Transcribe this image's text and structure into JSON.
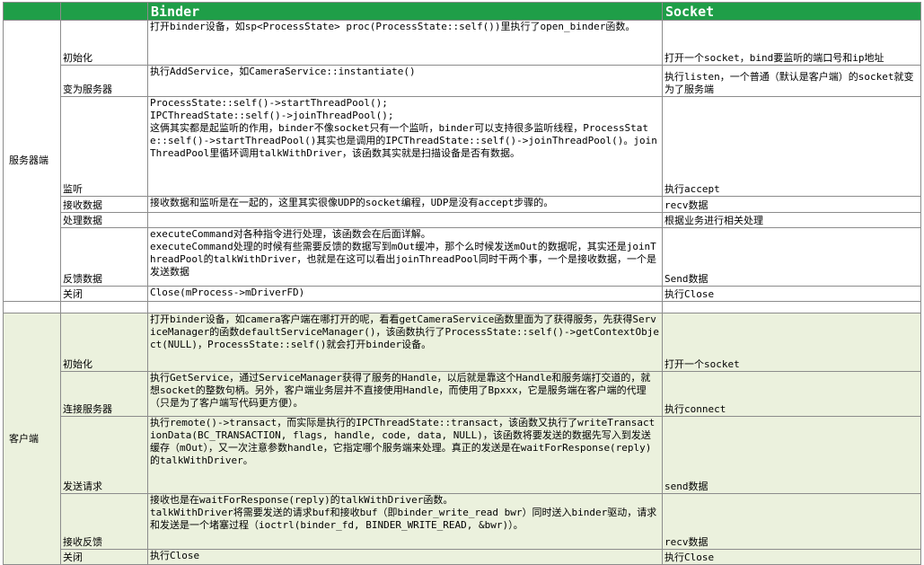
{
  "header": {
    "c0": "",
    "c1": "",
    "binder": "Binder",
    "socket": "Socket"
  },
  "server": {
    "section": "服务器端",
    "rows": [
      {
        "label": "初始化",
        "binder": [
          "打开binder设备，如sp<ProcessState> proc(ProcessState::self())里执行了open_binder函数。"
        ],
        "socket": "打开一个socket，bind要监听的端口号和ip地址"
      },
      {
        "label": "变为服务器",
        "binder": [
          "执行AddService，如CameraService::instantiate()"
        ],
        "socket": "执行listen，一个普通（默认是客户端）的socket就变为了服务端"
      },
      {
        "label": "监听",
        "binder": [
          "ProcessState::self()->startThreadPool();",
          "IPCThreadState::self()->joinThreadPool();",
          "这俩其实都是起监听的作用，binder不像socket只有一个监听，binder可以支持很多监听线程，ProcessState::self()->startThreadPool()其实也是调用的IPCThreadState::self()->joinThreadPool()。joinThreadPool里循环调用talkWithDriver，该函数其实就是扫描设备是否有数据。"
        ],
        "socket": "执行accept"
      },
      {
        "label": "接收数据",
        "binder": [
          "接收数据和监听是在一起的，这里其实很像UDP的socket编程，UDP是没有accept步骤的。"
        ],
        "socket": "recv数据"
      },
      {
        "label": "处理数据",
        "binder": [
          ""
        ],
        "socket": "根据业务进行相关处理"
      },
      {
        "label": "反馈数据",
        "binder": [
          "executeCommand对各种指令进行处理，该函数会在后面详解。",
          "executeCommand处理的时候有些需要反馈的数据写到mOut缓冲，那个么时候发送mOut的数据呢，其实还是joinThreadPool的talkWithDriver，也就是在这可以看出joinThreadPool同时干两个事，一个是接收数据，一个是发送数据"
        ],
        "socket": "Send数据"
      },
      {
        "label": "关闭",
        "binder": [
          "Close(mProcess->mDriverFD)"
        ],
        "socket": "执行Close"
      }
    ]
  },
  "client": {
    "section": "客户端",
    "rows": [
      {
        "label": "初始化",
        "binder": [
          "打开binder设备，如camera客户端在哪打开的呢，看看getCameraService函数里面为了获得服务，先获得ServiceManager的函数defaultServiceManager()，该函数执行了ProcessState::self()->getContextObject(NULL)，ProcessState::self()就会打开binder设备。"
        ],
        "socket": "打开一个socket"
      },
      {
        "label": "连接服务器",
        "binder": [
          "执行GetService，通过ServiceManager获得了服务的Handle，以后就是靠这个Handle和服务端打交道的，就想socket的整数句柄。另外，客户端业务层并不直接使用Handle，而使用了Bpxxx，它是服务端在客户端的代理（只是为了客户端写代码更方便）。"
        ],
        "socket": "执行connect"
      },
      {
        "label": "发送请求",
        "binder": [
          "执行remote()->transact，而实际是执行的IPCThreadState::transact，该函数又执行了writeTransactionData(BC_TRANSACTION, flags, handle, code, data, NULL)，该函数将要发送的数据先写入到发送缓存（mOut），又一次注意参数handle，它指定哪个服务端来处理。真正的发送是在waitForResponse(reply)的talkWithDriver。"
        ],
        "socket": "send数据"
      },
      {
        "label": "接收反馈",
        "binder": [
          "接收也是在waitForResponse(reply)的talkWithDriver函数。",
          "talkWithDriver将需要发送的请求buf和接收buf（即binder_write_read bwr）同时送入binder驱动，请求和发送是一个堵塞过程（ioctrl(binder_fd, BINDER_WRITE_READ, &bwr)）。"
        ],
        "socket": "recv数据"
      },
      {
        "label": "关闭",
        "binder": [
          "执行Close"
        ],
        "socket": "执行Close"
      }
    ]
  },
  "colors": {
    "header_bg": "#1f9e48",
    "client_bg": "#ebf1dd",
    "grid": "#8c8c8c"
  }
}
